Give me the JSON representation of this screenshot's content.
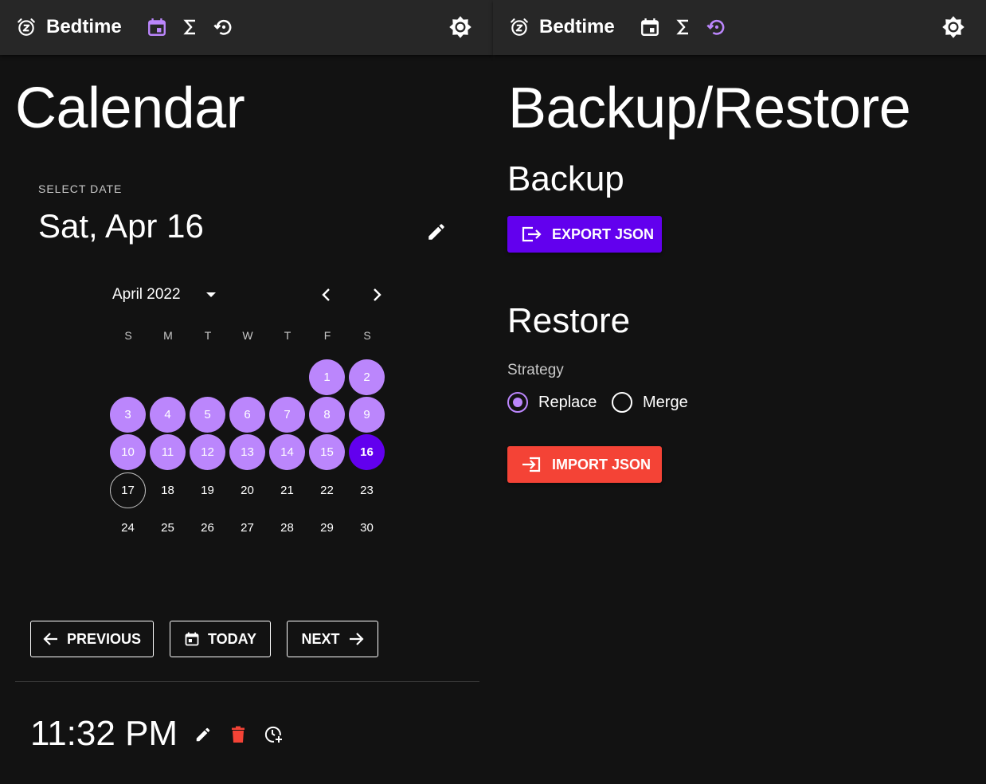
{
  "colors": {
    "accent": "#bb86fc",
    "primary": "#6200ee",
    "danger": "#f44336",
    "appbar": "#272727",
    "background": "#121212"
  },
  "left": {
    "appbar": {
      "title": "Bedtime",
      "icons": [
        "alarm-z-icon",
        "calendar-icon",
        "sigma-icon",
        "restore-icon",
        "brightness-icon"
      ],
      "active": "calendar"
    },
    "page_title": "Calendar",
    "picker": {
      "overline": "SELECT DATE",
      "selected_date": "Sat, Apr 16",
      "month_label": "April 2022",
      "weekdays": [
        "S",
        "M",
        "T",
        "W",
        "T",
        "F",
        "S"
      ],
      "days": [
        "1",
        "2",
        "3",
        "4",
        "5",
        "6",
        "7",
        "8",
        "9",
        "10",
        "11",
        "12",
        "13",
        "14",
        "15",
        "16",
        "17",
        "18",
        "19",
        "20",
        "21",
        "22",
        "23",
        "24",
        "25",
        "26",
        "27",
        "28",
        "29",
        "30"
      ],
      "first_weekday_index": 5,
      "marked_days": [
        1,
        2,
        3,
        4,
        5,
        6,
        7,
        8,
        9,
        10,
        11,
        12,
        13,
        14,
        15
      ],
      "selected_day": 16,
      "today_day": 17
    },
    "nav": {
      "previous": "PREVIOUS",
      "today": "TODAY",
      "next": "NEXT"
    },
    "entry": {
      "time": "11:32 PM"
    }
  },
  "right": {
    "appbar": {
      "title": "Bedtime",
      "active": "restore"
    },
    "page_title": "Backup/Restore",
    "backup": {
      "heading": "Backup",
      "export_label": "EXPORT JSON"
    },
    "restore": {
      "heading": "Restore",
      "strategy_label": "Strategy",
      "options": [
        {
          "label": "Replace",
          "checked": true
        },
        {
          "label": "Merge",
          "checked": false
        }
      ],
      "import_label": "IMPORT JSON"
    }
  }
}
